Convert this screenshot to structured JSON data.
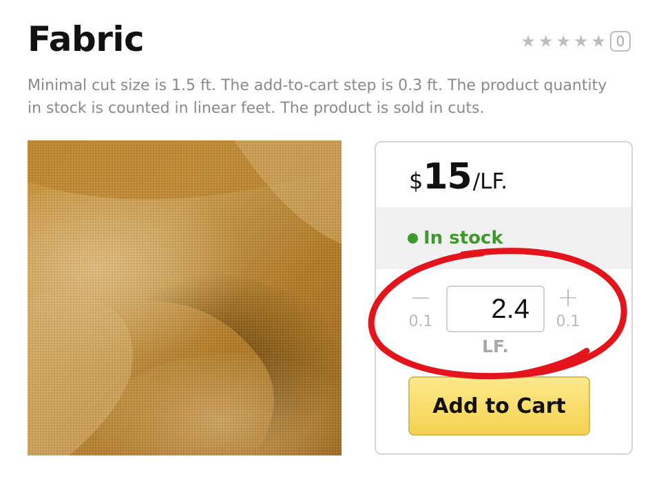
{
  "product": {
    "title": "Fabric",
    "description": "Minimal cut size is 1.5 ft. The add-to-cart step is 0.3 ft. The product quantity in stock is counted in linear feet. The product is sold in cuts.",
    "rating": {
      "stars": 5,
      "filled": 0,
      "count": "0"
    }
  },
  "buy_box": {
    "price_currency": "$",
    "price_amount": "15",
    "price_unit": "/LF.",
    "stock_label": "In stock",
    "quantity": {
      "minus_icon": "minus-icon",
      "plus_icon": "plus-icon",
      "minus_step": "0.1",
      "plus_step": "0.1",
      "value": "2.4",
      "unit": "LF."
    },
    "add_to_cart_label": "Add to Cart"
  },
  "colors": {
    "stock": "#3f9a2e",
    "button": "#f4d24f",
    "annotation": "#e3141b",
    "muted": "#8a8a8a"
  }
}
